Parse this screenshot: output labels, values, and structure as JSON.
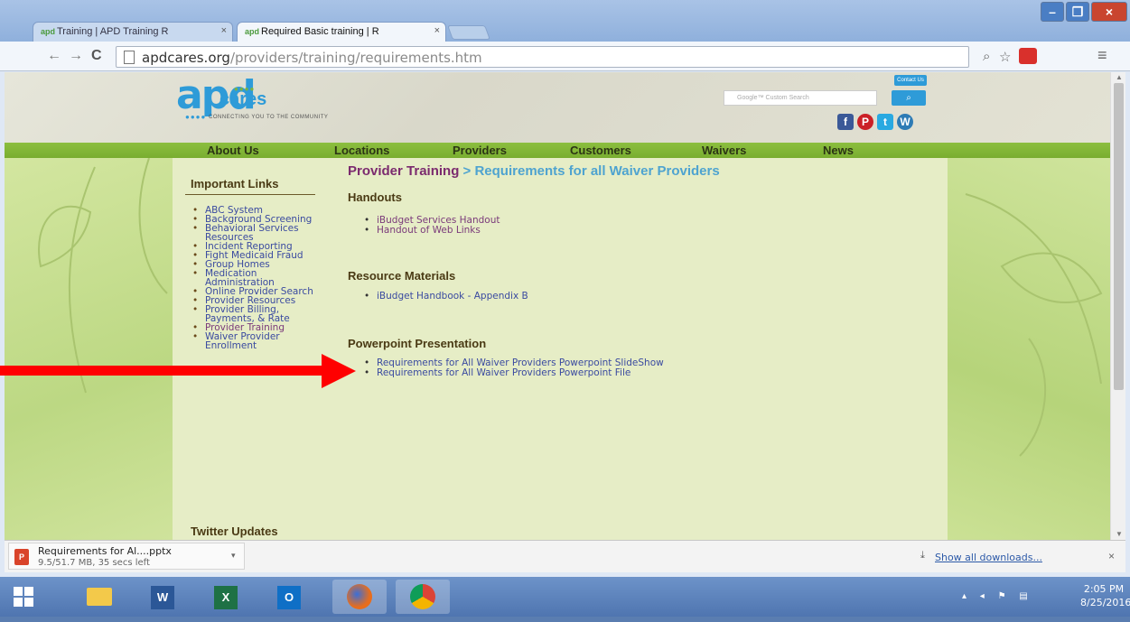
{
  "browser": {
    "tabs": [
      {
        "label": "Training | APD Training R",
        "active": false
      },
      {
        "label": "Required Basic training | R",
        "active": true
      }
    ],
    "tab_close": "×",
    "favicon_text": "apd",
    "address": {
      "host": "apdcares.org",
      "path": "/providers/training/requirements.htm"
    },
    "nav": {
      "back": "←",
      "forward": "→",
      "reload": "C"
    },
    "toolbar_icons": {
      "zoom": "⌕",
      "star": "☆",
      "menu": "≡"
    },
    "window_buttons": {
      "minimize": "–",
      "restore": "❐",
      "close": "×"
    }
  },
  "site": {
    "logo": {
      "main": "apd",
      "sub": "cares",
      "tagline": "CONNECTING YOU TO THE COMMUNITY"
    },
    "contact_label": "Contact Us",
    "search_placeholder": "Google™ Custom Search",
    "search_button": "⌕",
    "social_icons": [
      "facebook-icon",
      "pinterest-icon",
      "twitter-icon",
      "wordpress-icon"
    ],
    "nav": [
      "About Us",
      "Locations",
      "Providers",
      "Customers",
      "Waivers",
      "News"
    ]
  },
  "sidebar": {
    "heading": "Important Links",
    "items": [
      "ABC System",
      "Background Screening",
      "Behavioral Services Resources",
      "Incident Reporting",
      "Fight Medicaid Fraud",
      "Group Homes",
      "Medication Administration",
      "Online Provider Search",
      "Provider Resources",
      "Provider Billing, Payments, & Rate",
      "Provider Training",
      "Waiver Provider Enrollment"
    ],
    "twitter_heading": "Twitter Updates"
  },
  "main": {
    "title_link": "Provider Training",
    "title_rest": " > Requirements for all Waiver Providers",
    "sections": [
      {
        "heading": "Handouts",
        "links": [
          "iBudget Services Handout",
          "Handout of Web Links"
        ]
      },
      {
        "heading": "Resource Materials",
        "links": [
          "iBudget Handbook - Appendix B"
        ]
      },
      {
        "heading": "Powerpoint Presentation",
        "links": [
          "Requirements for All Waiver Providers Powerpoint SlideShow",
          "Requirements for All Waiver Providers Powerpoint File"
        ]
      }
    ]
  },
  "downloads": {
    "file_name": "Requirements for Al....pptx",
    "status": "9.5/51.7 MB, 35 secs left",
    "file_icon_text": "P",
    "show_all": "Show all downloads...",
    "close": "×"
  },
  "taskbar": {
    "apps": [
      "windows-start",
      "file-explorer",
      "word",
      "excel",
      "outlook",
      "firefox",
      "chrome"
    ],
    "time": "2:05 PM",
    "date": "8/25/2016"
  },
  "colors": {
    "accent": "#2e9bd8",
    "nav_green": "#8cbf3f",
    "arrow": "#ff0000"
  }
}
